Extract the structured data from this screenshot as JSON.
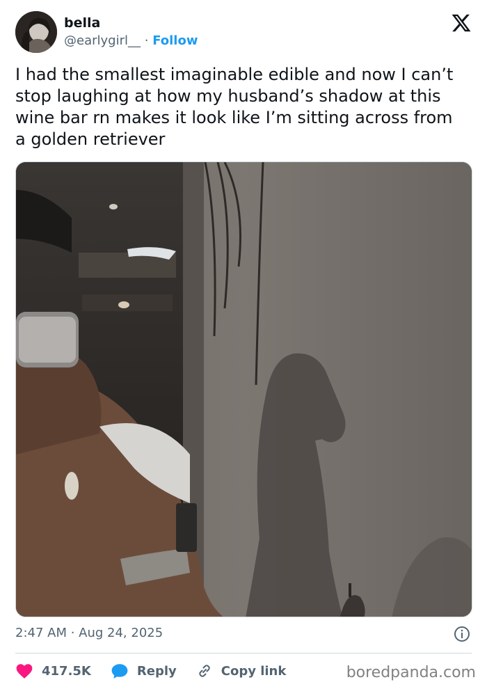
{
  "author": {
    "name": "bella",
    "handle": "@earlygirl__",
    "separator": "·",
    "follow_label": "Follow"
  },
  "tweet": {
    "text": "I had the smallest imaginable edible and now I can’t stop laughing at how my husband’s shadow at this wine bar rn makes it look like I’m sitting across from a golden retriever",
    "timestamp": "2:47 AM · Aug 24, 2025"
  },
  "actions": {
    "likes": "417.5K",
    "reply_label": "Reply",
    "copy_label": "Copy link"
  },
  "watermark": "boredpanda.com",
  "icons": {
    "platform": "x-logo-icon",
    "like": "heart-icon",
    "reply": "speech-bubble-icon",
    "copy": "link-icon",
    "info": "info-icon"
  },
  "colors": {
    "accent": "#1d9bf0",
    "like": "#f91880",
    "text": "#0f1419",
    "secondary": "#536471",
    "border": "#cfd9de"
  }
}
